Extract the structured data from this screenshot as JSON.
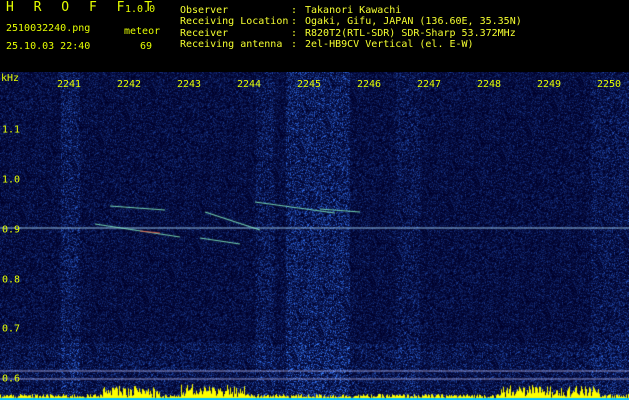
{
  "app": {
    "name": "H R O F F T",
    "version": "1.0.0"
  },
  "file": {
    "name": "2510032240.png",
    "datetime": "25.10.03 22:40"
  },
  "meteor": {
    "label": "meteor",
    "count": "69"
  },
  "station": [
    {
      "key": "Observer",
      "value": "Takanori Kawachi"
    },
    {
      "key": "Receiving Location",
      "value": "Ogaki, Gifu, JAPAN (136.60E, 35.35N)"
    },
    {
      "key": "Receiver",
      "value": "R820T2(RTL-SDR) SDR-Sharp 53.372MHz"
    },
    {
      "key": "Receiving antenna",
      "value": "2el-HB9CV Vertical (el. E-W)"
    }
  ],
  "colon": ":",
  "axis": {
    "unit": "kHz",
    "x_ticks": [
      "2241",
      "2242",
      "2243",
      "2244",
      "2245",
      "2246",
      "2247",
      "2248",
      "2249",
      "2250"
    ],
    "y_ticks": [
      "1.1",
      "1.0",
      "0.9",
      "0.8",
      "0.7",
      "0.6"
    ]
  },
  "colors": {
    "text": "#e6ff00",
    "carrier": "#b0e0ff",
    "background": "#000010"
  }
}
